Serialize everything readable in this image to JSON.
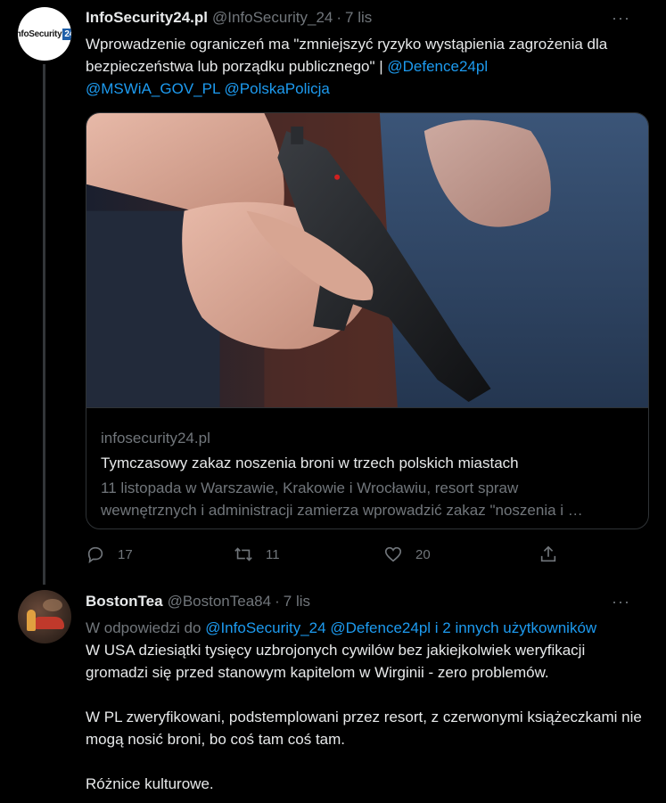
{
  "tweet1": {
    "avatar_logo_text": "InfoSecurity",
    "avatar_logo_box": "24",
    "name": "InfoSecurity24.pl",
    "handle": "@InfoSecurity_24",
    "separator": "·",
    "time": "7 lis",
    "more": "···",
    "text_plain": "Wprowadzenie ograniczeń ma \"zmniejszyć ryzyko wystąpienia zagrożenia dla bezpieczeństwa lub porządku publicznego\" | ",
    "mention_1": "@Defence24pl",
    "mention_2": "@MSWiA_GOV_PL",
    "mention_3": "@PolskaPolicja",
    "card": {
      "domain": "infosecurity24.pl",
      "title": "Tymczasowy zakaz noszenia broni w trzech polskich miastach",
      "desc_line1": "11 listopada w Warszawie, Krakowie i Wrocławiu, resort spraw",
      "desc_line2": "wewnętrznych i administracji zamierza wprowadzić zakaz \"noszenia i …"
    },
    "actions": {
      "replies": "17",
      "retweets": "11",
      "likes": "20"
    }
  },
  "tweet2": {
    "name": "BostonTea",
    "handle": "@BostonTea84",
    "separator": "·",
    "time": "7 lis",
    "more": "···",
    "reply_prefix": "W odpowiedzi do",
    "reply_mention_1": "@InfoSecurity_24",
    "reply_mention_2": "@Defence24pl",
    "reply_others": " i 2 innych użytkowników",
    "para1": "W USA dziesiątki tysięcy uzbrojonych cywilów bez jakiejkolwiek weryfikacji gromadzi się przed stanowym kapitelom w Wirginii - zero problemów.",
    "para2": "W PL zweryfikowani, podstemplowani przez resort, z czerwonymi książeczkami nie mogą nosić broni, bo coś tam coś tam.",
    "para3": "Różnice kulturowe."
  },
  "colors": {
    "background": "#000000",
    "text": "#e7e9ea",
    "muted": "#71767b",
    "link": "#1d9bf0",
    "border": "#2f3336"
  },
  "icons": [
    "reply-icon",
    "retweet-icon",
    "like-icon",
    "share-icon",
    "more-icon"
  ]
}
